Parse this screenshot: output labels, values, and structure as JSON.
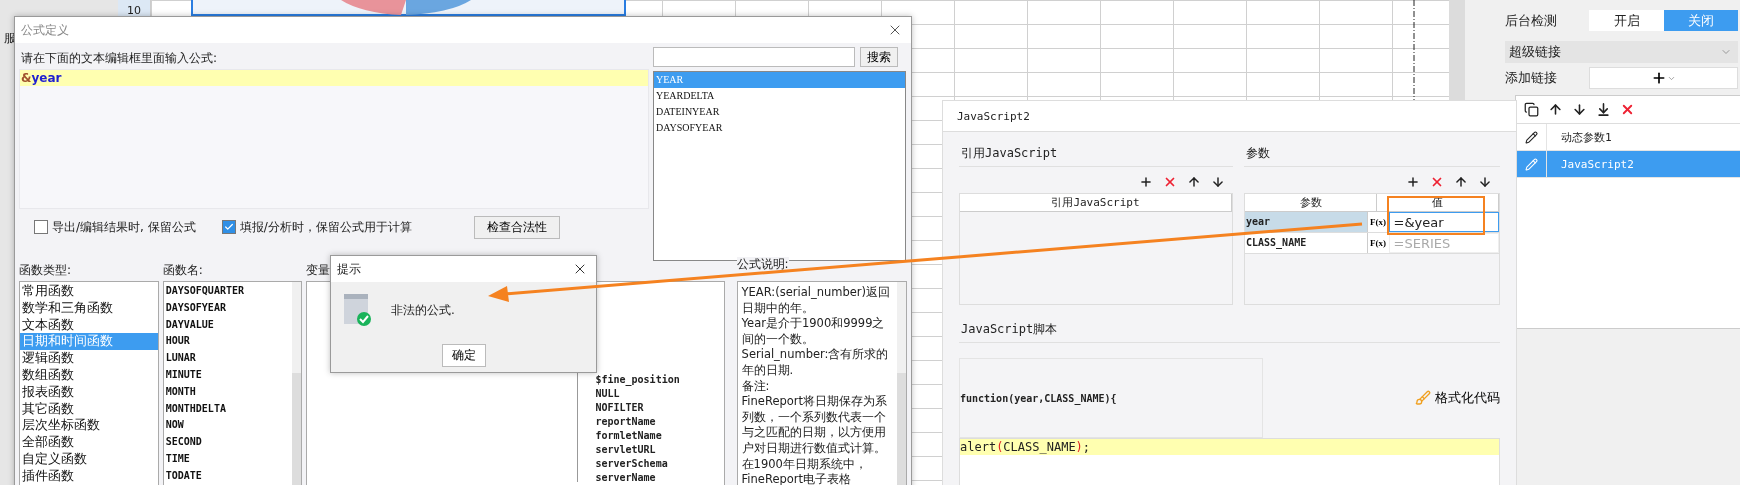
{
  "background": {
    "left_label": "服",
    "row_number": "10"
  },
  "formula_dialog": {
    "title": "公式定义",
    "prompt": "请在下面的文本编辑框里面输入公式:",
    "formula_tokens": [
      {
        "text": "&",
        "kind": "operator"
      },
      {
        "text": "year",
        "kind": "identifier"
      }
    ],
    "search_button": "搜索",
    "results": [
      {
        "label": "YEAR",
        "selected": true
      },
      {
        "label": "YEARDELTA",
        "selected": false
      },
      {
        "label": "DATEINYEAR",
        "selected": false
      },
      {
        "label": "DAYSOFYEAR",
        "selected": false
      }
    ],
    "options": [
      {
        "label": "导出/编辑结果时, 保留公式",
        "checked": false
      },
      {
        "label": "填报/分析时，保留公式用于计算",
        "checked": true
      }
    ],
    "check_button": "检查合法性",
    "categories_label": "函数类型:",
    "categories": [
      {
        "label": "常用函数",
        "selected": false
      },
      {
        "label": "数学和三角函数",
        "selected": false
      },
      {
        "label": "文本函数",
        "selected": false
      },
      {
        "label": "日期和时间函数",
        "selected": true
      },
      {
        "label": "逻辑函数",
        "selected": false
      },
      {
        "label": "数组函数",
        "selected": false
      },
      {
        "label": "报表函数",
        "selected": false
      },
      {
        "label": "其它函数",
        "selected": false
      },
      {
        "label": "层次坐标函数",
        "selected": false
      },
      {
        "label": "全部函数",
        "selected": false
      },
      {
        "label": "自定义函数",
        "selected": false
      },
      {
        "label": "插件函数",
        "selected": false
      }
    ],
    "functions_label": "函数名:",
    "functions": [
      {
        "label": "DAYSOFQUARTER",
        "selected": false
      },
      {
        "label": "DAYSOFYEAR",
        "selected": false
      },
      {
        "label": "DAYVALUE",
        "selected": false
      },
      {
        "label": "HOUR",
        "selected": false
      },
      {
        "label": "LUNAR",
        "selected": false
      },
      {
        "label": "MINUTE",
        "selected": false
      },
      {
        "label": "MONTH",
        "selected": false
      },
      {
        "label": "MONTHDELTA",
        "selected": false
      },
      {
        "label": "NOW",
        "selected": false
      },
      {
        "label": "SECOND",
        "selected": false
      },
      {
        "label": "TIME",
        "selected": false
      },
      {
        "label": "TODATE",
        "selected": false
      }
    ],
    "variables_label": "变量",
    "variables": [
      "$fine_position",
      "NULL",
      "NOFILTER",
      "reportName",
      "formletName",
      "servletURL",
      "serverSchema",
      "serverName"
    ],
    "description_label": "公式说明:",
    "description": [
      "YEAR:(serial_number)返回日期中的年。",
      "Year是介于1900和9999之间的一个数。",
      "Serial_number:含有所求的年的日期.",
      "备注:",
      "FineReport将日期保存为系列数，一个系列数代表一个与之匹配的日期，以方便用户对日期进行数值式计算。在1900年日期系统中，FineReport电子表格"
    ]
  },
  "alert": {
    "title": "提示",
    "message": "非法的公式.",
    "button": "确定"
  },
  "js_panel": {
    "title": "JavaScript2",
    "reference_label": "引用JavaScript",
    "reference_column": "引用JavaScript",
    "params_label": "参数",
    "params_columns": [
      "参数",
      "值"
    ],
    "params": [
      {
        "name": "year",
        "fx": "F(x)",
        "value": "=&year",
        "selected": true,
        "disabled": false
      },
      {
        "name": "CLASS_NAME",
        "fx": "F(x)",
        "value": "=SERIES",
        "selected": false,
        "disabled": true
      }
    ],
    "script_label": "JavaScript脚本",
    "signature": "function(year,CLASS_NAME){",
    "format_button": "格式化代码",
    "code_tokens": [
      {
        "text": "alert",
        "kind": "plain"
      },
      {
        "text": "(",
        "kind": "paren"
      },
      {
        "text": "CLASS_NAME",
        "kind": "plain"
      },
      {
        "text": ")",
        "kind": "paren"
      },
      {
        "text": ";",
        "kind": "plain"
      }
    ]
  },
  "sidebar": {
    "check_label": "后台检测",
    "check_options": [
      {
        "label": "开启",
        "selected": false
      },
      {
        "label": "关闭",
        "selected": true
      }
    ],
    "hyperlink_title": "超级链接",
    "add_label": "添加链接",
    "links": [
      {
        "label": "动态参数1",
        "selected": false
      },
      {
        "label": "JavaScript2",
        "selected": true
      }
    ]
  }
}
